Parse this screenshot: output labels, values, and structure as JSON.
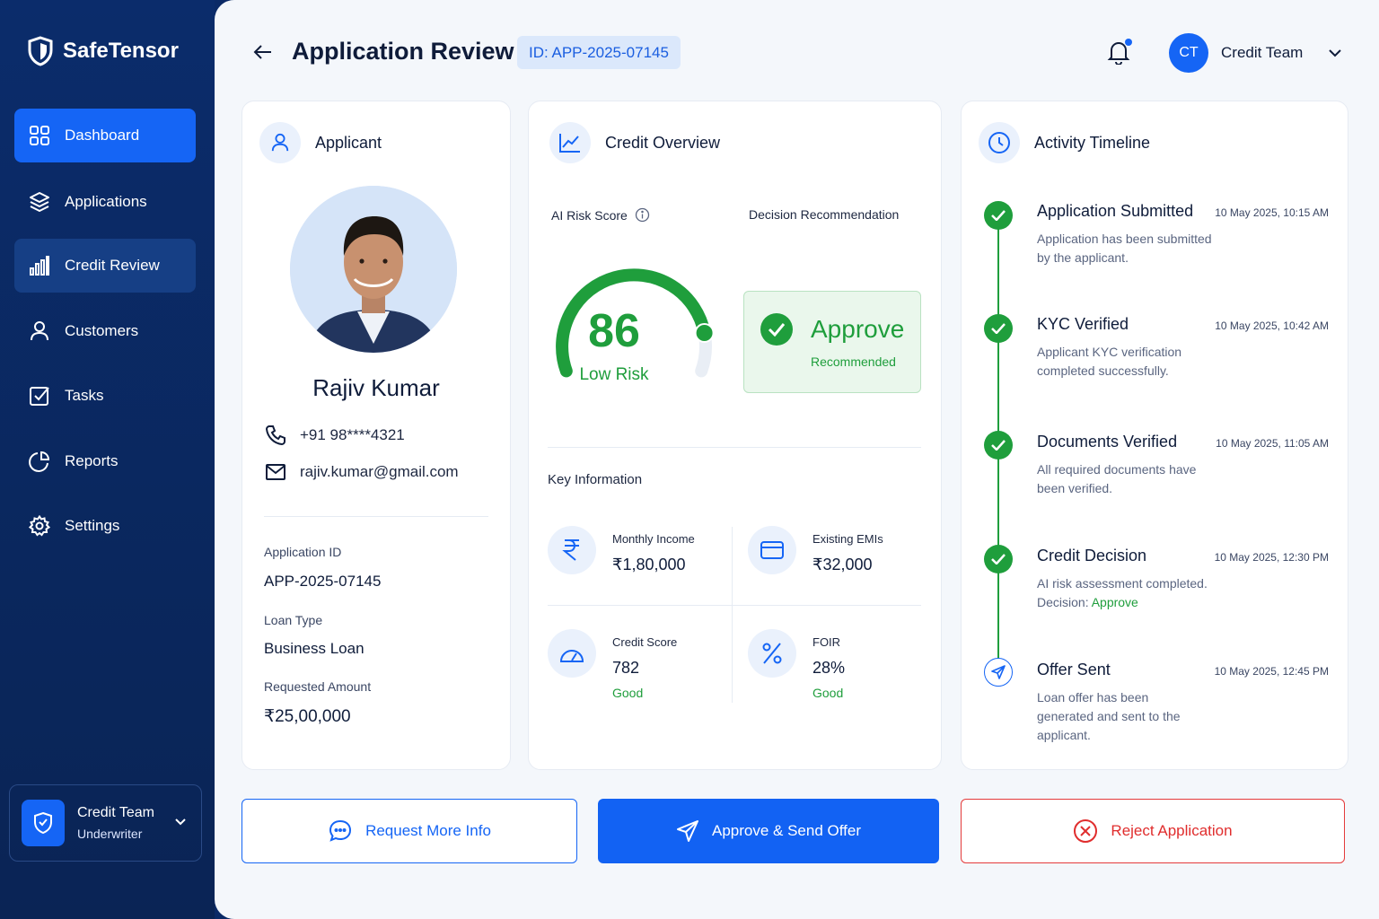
{
  "brand": {
    "name": "SafeTensor"
  },
  "sidebar": {
    "items": [
      {
        "label": "Dashboard",
        "icon": "grid-icon"
      },
      {
        "label": "Applications",
        "icon": "layers-icon"
      },
      {
        "label": "Credit Review",
        "icon": "bar-chart-icon"
      },
      {
        "label": "Customers",
        "icon": "user-icon"
      },
      {
        "label": "Tasks",
        "icon": "checkbox-icon"
      },
      {
        "label": "Reports",
        "icon": "pie-chart-icon"
      },
      {
        "label": "Settings",
        "icon": "gear-icon"
      }
    ],
    "user": {
      "name": "Credit Team",
      "role": "Underwriter"
    }
  },
  "header": {
    "title": "Application Review",
    "app_id": "ID: APP-2025-07145",
    "avatar_initials": "CT",
    "user_name": "Credit Team"
  },
  "applicant": {
    "heading": "Applicant",
    "name": "Rajiv Kumar",
    "phone": "+91 98****4321",
    "email": "rajiv.kumar@gmail.com",
    "application_id_label": "Application ID",
    "application_id": "APP-2025-07145",
    "loan_type_label": "Loan Type",
    "loan_type": "Business Loan",
    "amount_label": "Requested Amount",
    "amount": "₹25,00,000"
  },
  "credit": {
    "heading": "Credit Overview",
    "risk_label": "AI Risk Score",
    "decision_label": "Decision Recommendation",
    "score": "86",
    "score_max": 100,
    "risk_level": "Low Risk",
    "decision": "Approve",
    "decision_sub": "Recommended",
    "key_info_label": "Key Information",
    "key_info": [
      {
        "label": "Monthly Income",
        "value": "₹1,80,000",
        "note": ""
      },
      {
        "label": "Existing EMIs",
        "value": "₹32,000",
        "note": ""
      },
      {
        "label": "Credit Score",
        "value": "782",
        "note": "Good"
      },
      {
        "label": "FOIR",
        "value": "28%",
        "note": "Good"
      }
    ]
  },
  "timeline": {
    "heading": "Activity Timeline",
    "events": [
      {
        "title": "Application Submitted",
        "time": "10 May 2025, 10:15 AM",
        "desc": "Application has been submitted by the applicant."
      },
      {
        "title": "KYC Verified",
        "time": "10 May 2025, 10:42 AM",
        "desc": "Applicant KYC verification completed successfully."
      },
      {
        "title": "Documents Verified",
        "time": "10 May 2025, 11:05 AM",
        "desc": "All required documents have been verified."
      },
      {
        "title": "Credit Decision",
        "time": "10 May 2025, 12:30 PM",
        "desc": "AI risk assessment completed.",
        "desc2_label": "Decision: ",
        "desc2_value": "Approve"
      },
      {
        "title": "Offer Sent",
        "time": "10 May 2025, 12:45 PM",
        "desc": "Loan offer has been generated and sent to the applicant."
      }
    ]
  },
  "actions": {
    "request_info": "Request More Info",
    "approve": "Approve & Send Offer",
    "reject": "Reject Application"
  },
  "colors": {
    "primary": "#1565f5",
    "success": "#1f9e3c",
    "danger": "#e02d2d",
    "sidebar": "#0b2c6b"
  }
}
